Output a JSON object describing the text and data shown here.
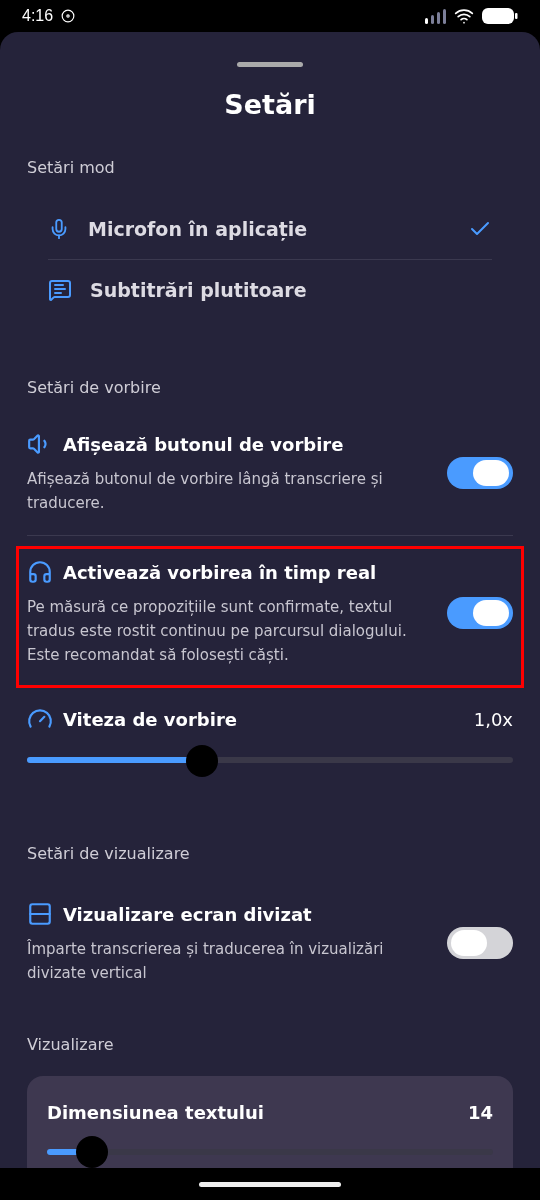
{
  "status_bar": {
    "time": "4:16"
  },
  "title": "Setări",
  "mode_section": {
    "heading": "Setări mod",
    "items": [
      {
        "kind": "mic",
        "label": "Microfon în aplicație",
        "selected": true
      },
      {
        "kind": "captions",
        "label": "Subtitrări plutitoare",
        "selected": false
      }
    ]
  },
  "speech_section": {
    "heading": "Setări de vorbire",
    "settings": [
      {
        "kind": "speaker",
        "title": "Afișează butonul de vorbire",
        "description": "Afișează butonul de vorbire lângă transcriere și traducere.",
        "on": true,
        "highlighted": false
      },
      {
        "kind": "headphones",
        "title": "Activează vorbirea în timp real",
        "description": "Pe măsură ce propozițiile sunt confirmate, textul tradus este rostit continuu pe parcursul dialogului. Este recomandat să folosești căști.",
        "on": true,
        "highlighted": true
      }
    ],
    "speed": {
      "label": "Viteza de vorbire",
      "reading": "1,0x",
      "level": 0.36
    }
  },
  "display_section": {
    "heading": "Setări de vizualizare",
    "settings": [
      {
        "kind": "split",
        "title": "Vizualizare ecran divizat",
        "description": "Împarte transcrierea și traducerea în vizualizări divizate vertical",
        "on": false,
        "highlighted": false
      }
    ]
  },
  "view_section": {
    "heading": "Vizualizare",
    "text_size": {
      "label": "Dimensiunea textului",
      "reading": "14",
      "level": 0.1
    }
  }
}
